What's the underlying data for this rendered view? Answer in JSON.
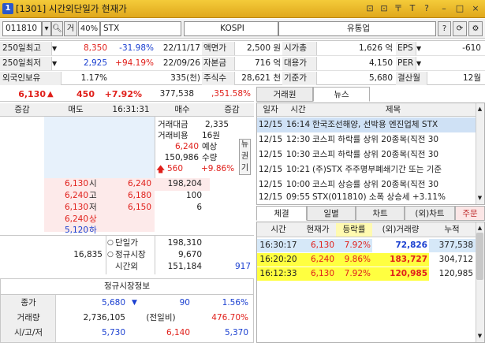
{
  "window": {
    "icon": "1",
    "title": "[1301] 시간외단일가 현재가",
    "buttons": [
      "⊡",
      "⊡",
      "〒",
      "T",
      "?",
      "–",
      "□",
      "×"
    ]
  },
  "toolbar": {
    "code": "011810",
    "search_icon": "search-icon",
    "mode": "거",
    "pct": "40%",
    "name": "STX",
    "market": "KOSPI",
    "type": "유통업",
    "help": "?"
  },
  "info": {
    "r1": {
      "label": "250일최고",
      "price": "8,350",
      "pct": "-31.98%",
      "date": "22/11/17",
      "l2": "액면가",
      "v2": "2,500 원",
      "l3": "시가총",
      "v3": "1,626 억",
      "l4": "EPS",
      "v4": "-610"
    },
    "r2": {
      "label": "250일최저",
      "price": "2,925",
      "pct": "+94.19%",
      "date": "22/09/26",
      "l2": "자본금",
      "v2": "716 억",
      "l3": "대용가",
      "v3": "4,150",
      "l4": "PER",
      "v4": ""
    },
    "r3": {
      "label": "외국인보유",
      "price": "1.17%",
      "pct": "",
      "date": "335(천)",
      "l2": "주식수",
      "v2": "28,621 천",
      "l3": "기준가",
      "v3": "5,680",
      "l4": "결산월",
      "v4": "12월"
    }
  },
  "price": {
    "current": "6,130",
    "arrow": "▲",
    "change": "450",
    "pct": "+7.92%",
    "volume": "377,538",
    "vol_pct": ",351.58%"
  },
  "hoga": {
    "head": {
      "col1": "증감",
      "col2": "매도",
      "time": "16:31:31",
      "col4": "매수",
      "col5": "증감"
    },
    "trade_amount_label": "거래대금",
    "trade_amount": "2,335",
    "trade_cost_label": "거래비용",
    "trade_cost": "16원",
    "exp_price": "6,240",
    "exp_price_label": "예상",
    "exp_qty": "150,986",
    "exp_qty_label": "수량",
    "exp_chg": "560",
    "exp_pct": "+9.86%",
    "side_tabs": [
      "뉴",
      "권",
      "기"
    ],
    "asks": [
      {
        "price": "6,130",
        "label": "시",
        "qty": "6,240",
        "bid": "198,204"
      },
      {
        "price": "6,240",
        "label": "고",
        "qty": "6,180",
        "bid": "100"
      },
      {
        "price": "6,130",
        "label": "저",
        "qty": "6,150",
        "bid": "6"
      },
      {
        "price": "6,240",
        "label": "상",
        "qty": "",
        "bid": ""
      },
      {
        "price": "5,120",
        "label": "하",
        "qty": "",
        "bid": ""
      }
    ],
    "sum_ask": "16,835",
    "sum_rows": [
      {
        "label": "단일가",
        "val": "198,310"
      },
      {
        "label": "정규시장",
        "val": "9,670"
      },
      {
        "label": "시간외",
        "val": "151,184"
      }
    ],
    "sum_bid": "917"
  },
  "regular": {
    "title": "정규시장정보",
    "rows": [
      {
        "label": "종가",
        "a": "5,680",
        "b": "90",
        "c": "1.56%"
      },
      {
        "label": "거래량",
        "a": "2,736,105",
        "b": "(전일비)",
        "c": "476.70%"
      },
      {
        "label": "시/고/저",
        "a": "5,730",
        "b": "6,140",
        "c": "5,370"
      }
    ]
  },
  "news": {
    "tabs": [
      "거래원",
      "뉴스"
    ],
    "head": {
      "date": "일자",
      "time": "시간",
      "title": "제목"
    },
    "rows": [
      {
        "date": "12/15",
        "time": "16:14",
        "title": "한국조선해양, 선박용 엔진업체 STX"
      },
      {
        "date": "12/15",
        "time": "12:30",
        "title": "코스피 하락률 상위 20종목(직전 30"
      },
      {
        "date": "12/15",
        "time": "10:30",
        "title": "코스피 하락률 상위 20종목(직전 30"
      },
      {
        "date": "12/15",
        "time": "10:21",
        "title": "(주)STX 주주명부폐쇄기간 또는 기준"
      },
      {
        "date": "12/15",
        "time": "10:00",
        "title": "코스피 상승률 상위 20종목(직전 30"
      },
      {
        "date": "12/15",
        "time": "09:55",
        "title": "STX(011810) 소폭 상승세 +3.11%"
      }
    ]
  },
  "ticks": {
    "tabs": [
      "체결",
      "일별",
      "차트",
      "(외)차트",
      "주문"
    ],
    "head": {
      "time": "시간",
      "price": "현재가",
      "pct": "등락률",
      "vol": "(외)거래량",
      "cum": "누적"
    },
    "rows": [
      {
        "time": "16:30:17",
        "price": "6,130",
        "pct": "7.92%",
        "vol": "72,826",
        "cum": "377,538"
      },
      {
        "time": "16:20:20",
        "price": "6,240",
        "pct": "9.86%",
        "vol": "183,727",
        "cum": "304,712"
      },
      {
        "time": "16:12:33",
        "price": "6,130",
        "pct": "7.92%",
        "vol": "120,985",
        "cum": "120,985"
      }
    ]
  },
  "colors": {
    "up": "#e0201b",
    "down": "#1a3fd0",
    "title": "#f0c030"
  }
}
